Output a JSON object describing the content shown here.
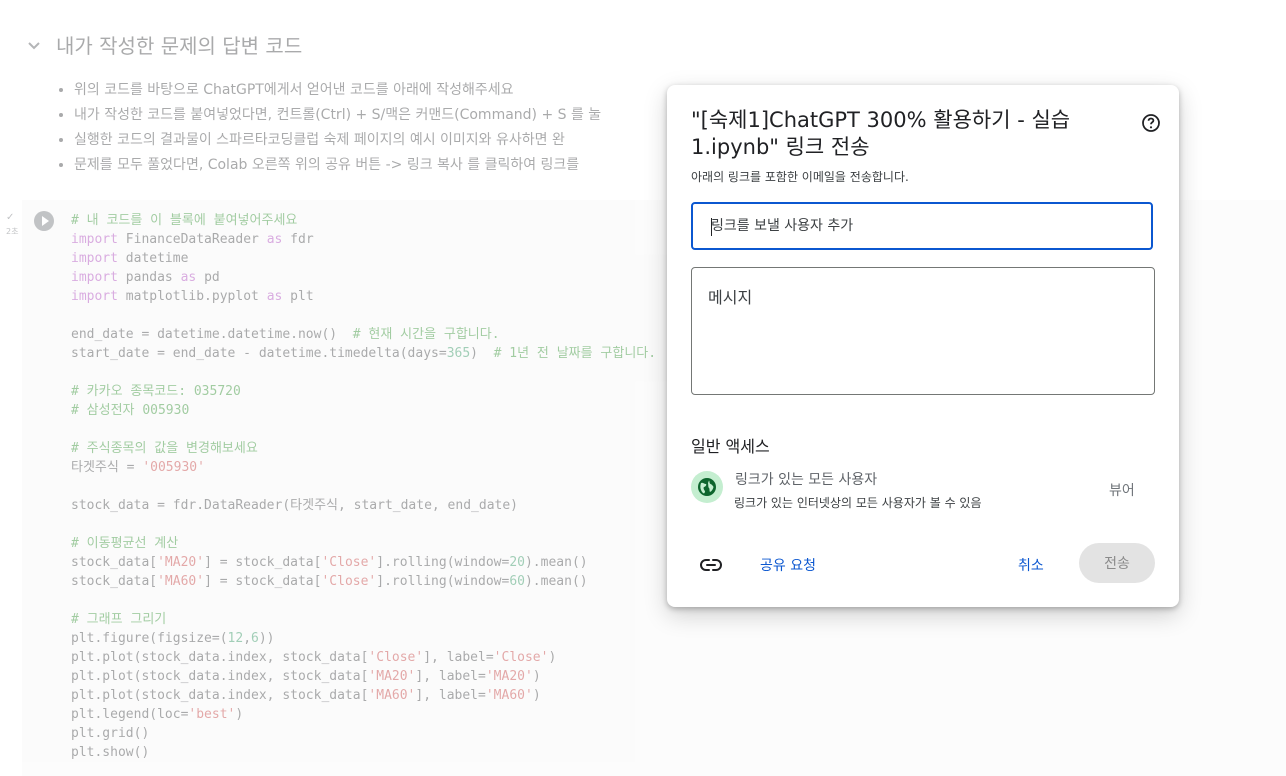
{
  "notebook": {
    "section_title": "내가 작성한 문제의 답변 코드",
    "bullets": [
      "위의 코드를 바탕으로 ChatGPT에게서 얻어낸 코드를 아래에 작성해주세요",
      "내가 작성한 코드를 붙여넣었다면, 컨트롤(Ctrl) + S/맥은 커맨드(Command) + S 를 눌",
      "실행한 코드의 결과물이 스파르타코딩클럽 숙제 페이지의 예시 이미지와 유사하면 완",
      "문제를 모두 풀었다면, Colab 오른쪽 위의 공유 버튼 -> 링크 복사 를 클릭하여 링크를"
    ],
    "cell_status_check": "✓",
    "cell_time": "2초",
    "code_lines": [
      [
        {
          "t": "# 내 코드를 이 블록에 붙여넣어주세요",
          "c": "c-com"
        }
      ],
      [
        {
          "t": "import",
          "c": "c-kw"
        },
        {
          "t": " FinanceDataReader ",
          "c": ""
        },
        {
          "t": "as",
          "c": "c-kw"
        },
        {
          "t": " fdr",
          "c": ""
        }
      ],
      [
        {
          "t": "import",
          "c": "c-kw"
        },
        {
          "t": " datetime",
          "c": ""
        }
      ],
      [
        {
          "t": "import",
          "c": "c-kw"
        },
        {
          "t": " pandas ",
          "c": ""
        },
        {
          "t": "as",
          "c": "c-kw"
        },
        {
          "t": " pd",
          "c": ""
        }
      ],
      [
        {
          "t": "import",
          "c": "c-kw"
        },
        {
          "t": " matplotlib.pyplot ",
          "c": ""
        },
        {
          "t": "as",
          "c": "c-kw"
        },
        {
          "t": " plt",
          "c": ""
        }
      ],
      [],
      [
        {
          "t": "end_date = datetime.datetime.now()  ",
          "c": ""
        },
        {
          "t": "# 현재 시간을 구합니다.",
          "c": "c-com"
        }
      ],
      [
        {
          "t": "start_date = end_date - datetime.timedelta(days=",
          "c": ""
        },
        {
          "t": "365",
          "c": "c-num"
        },
        {
          "t": ")  ",
          "c": ""
        },
        {
          "t": "# 1년 전 날짜를 구합니다.",
          "c": "c-com"
        }
      ],
      [],
      [
        {
          "t": "# 카카오 종목코드: 035720",
          "c": "c-com"
        }
      ],
      [
        {
          "t": "# 삼성전자 005930",
          "c": "c-com"
        }
      ],
      [],
      [
        {
          "t": "# 주식종목의 값을 변경해보세요",
          "c": "c-com"
        }
      ],
      [
        {
          "t": "타겟주식 = ",
          "c": ""
        },
        {
          "t": "'005930'",
          "c": "c-str"
        }
      ],
      [],
      [
        {
          "t": "stock_data = fdr.DataReader(타겟주식, start_date, end_date)",
          "c": ""
        }
      ],
      [],
      [
        {
          "t": "# 이동평균선 계산",
          "c": "c-com"
        }
      ],
      [
        {
          "t": "stock_data[",
          "c": ""
        },
        {
          "t": "'MA20'",
          "c": "c-str"
        },
        {
          "t": "] = stock_data[",
          "c": ""
        },
        {
          "t": "'Close'",
          "c": "c-str"
        },
        {
          "t": "].rolling(window=",
          "c": ""
        },
        {
          "t": "20",
          "c": "c-num"
        },
        {
          "t": ").mean()",
          "c": ""
        }
      ],
      [
        {
          "t": "stock_data[",
          "c": ""
        },
        {
          "t": "'MA60'",
          "c": "c-str"
        },
        {
          "t": "] = stock_data[",
          "c": ""
        },
        {
          "t": "'Close'",
          "c": "c-str"
        },
        {
          "t": "].rolling(window=",
          "c": ""
        },
        {
          "t": "60",
          "c": "c-num"
        },
        {
          "t": ").mean()",
          "c": ""
        }
      ],
      [],
      [
        {
          "t": "# 그래프 그리기",
          "c": "c-com"
        }
      ],
      [
        {
          "t": "plt.figure(figsize=(",
          "c": ""
        },
        {
          "t": "12",
          "c": "c-num"
        },
        {
          "t": ",",
          "c": ""
        },
        {
          "t": "6",
          "c": "c-num"
        },
        {
          "t": "))",
          "c": ""
        }
      ],
      [
        {
          "t": "plt.plot(stock_data.index, stock_data[",
          "c": ""
        },
        {
          "t": "'Close'",
          "c": "c-str"
        },
        {
          "t": "], label=",
          "c": ""
        },
        {
          "t": "'Close'",
          "c": "c-str"
        },
        {
          "t": ")",
          "c": ""
        }
      ],
      [
        {
          "t": "plt.plot(stock_data.index, stock_data[",
          "c": ""
        },
        {
          "t": "'MA20'",
          "c": "c-str"
        },
        {
          "t": "], label=",
          "c": ""
        },
        {
          "t": "'MA20'",
          "c": "c-str"
        },
        {
          "t": ")",
          "c": ""
        }
      ],
      [
        {
          "t": "plt.plot(stock_data.index, stock_data[",
          "c": ""
        },
        {
          "t": "'MA60'",
          "c": "c-str"
        },
        {
          "t": "], label=",
          "c": ""
        },
        {
          "t": "'MA60'",
          "c": "c-str"
        },
        {
          "t": ")",
          "c": ""
        }
      ],
      [
        {
          "t": "plt.legend(loc=",
          "c": ""
        },
        {
          "t": "'best'",
          "c": "c-str"
        },
        {
          "t": ")",
          "c": ""
        }
      ],
      [
        {
          "t": "plt.grid()",
          "c": ""
        }
      ],
      [
        {
          "t": "plt.show()",
          "c": ""
        }
      ]
    ]
  },
  "dialog": {
    "title": "\"[숙제1]ChatGPT 300% 활용하기 - 실습 1.ipynb\" 링크 전송",
    "subtitle": "아래의 링크를 포함한 이메일을 전송합니다.",
    "recipient_placeholder": "링크를 보낼 사용자 추가",
    "message_placeholder": "메시지",
    "general_access_title": "일반 액세스",
    "access_name": "링크가 있는 모든 사용자",
    "access_description": "링크가 있는 인터넷상의 모든 사용자가 볼 수 있음",
    "role": "뷰어",
    "share_request": "공유 요청",
    "cancel": "취소",
    "send": "전송"
  },
  "colors": {
    "accent": "#0b57d0",
    "globe_bg": "#c4eed0",
    "globe_fg": "#0d652d"
  }
}
